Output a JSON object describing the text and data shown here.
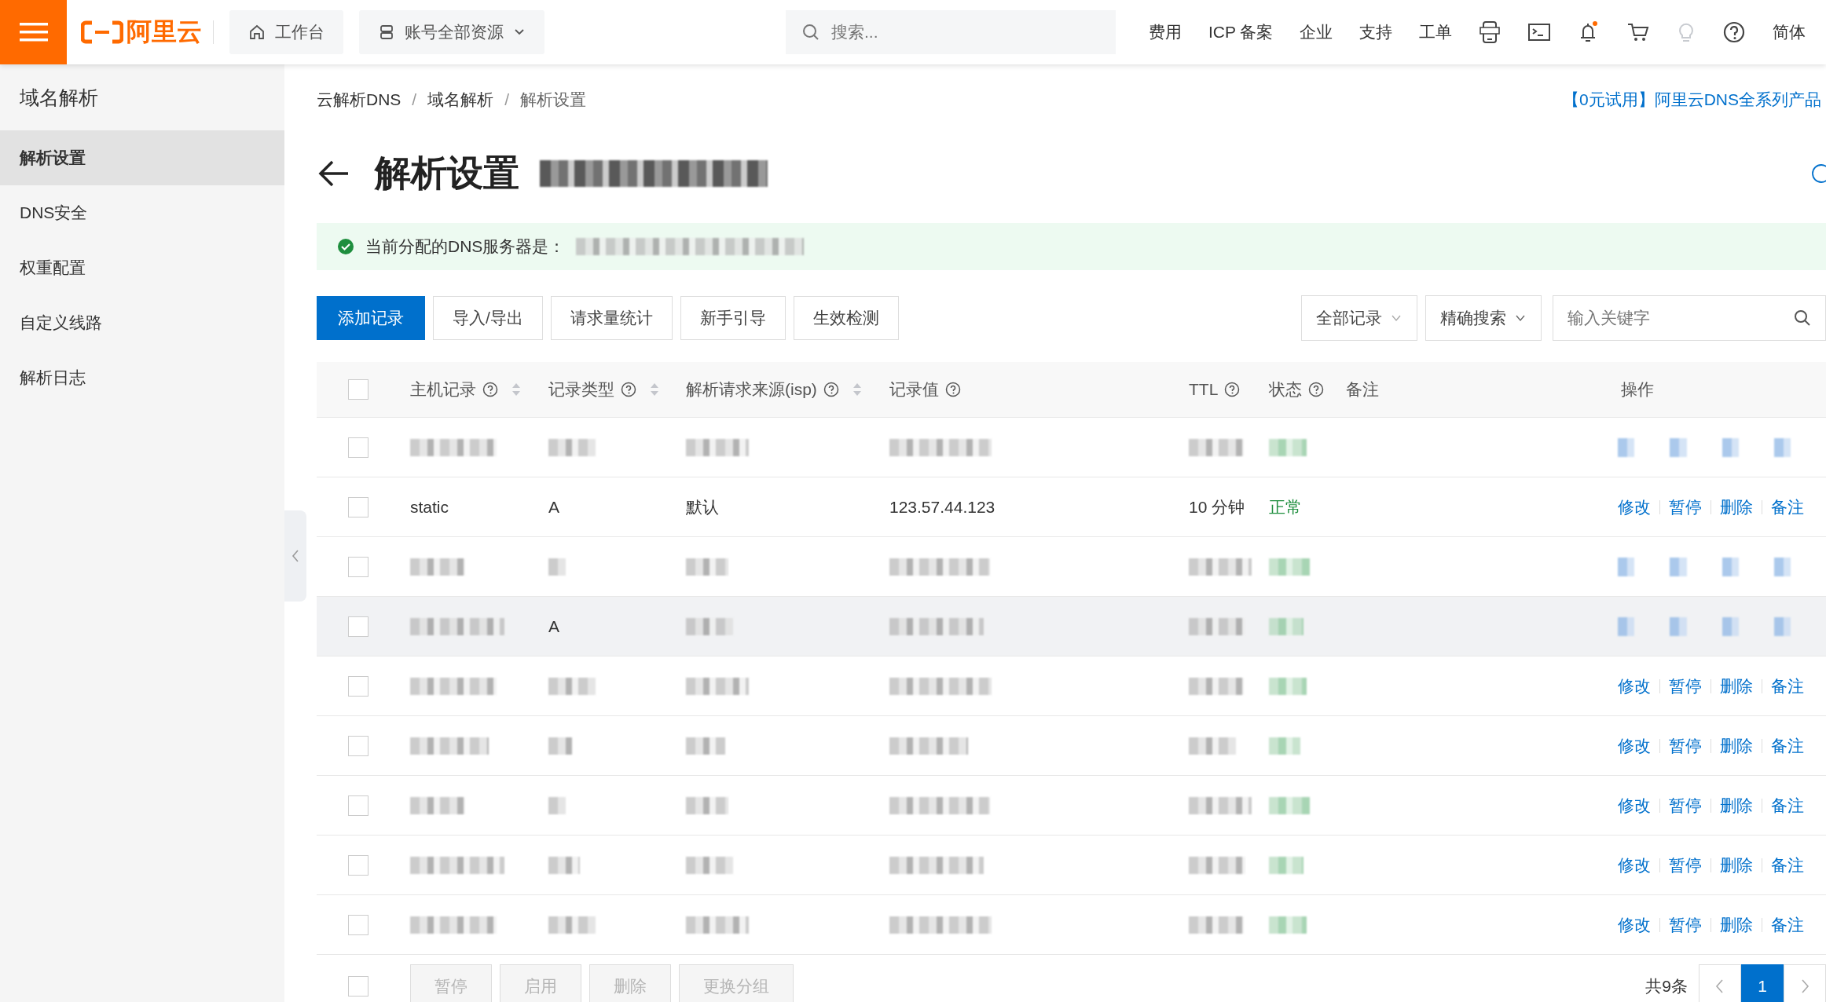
{
  "topbar": {
    "logo_text": "阿里云",
    "workbench": "工作台",
    "resources": "账号全部资源",
    "search": {
      "placeholder": "搜索..."
    },
    "nav": [
      "费用",
      "ICP 备案",
      "企业",
      "支持",
      "工单"
    ],
    "icons": [
      {
        "kind": "app"
      },
      {
        "kind": "terminal"
      },
      {
        "kind": "bell"
      },
      {
        "kind": "cart"
      },
      {
        "kind": "bulb"
      },
      {
        "kind": "help"
      }
    ],
    "language": "简体"
  },
  "sidebar": {
    "title": "域名解析",
    "items": [
      {
        "label": "解析设置",
        "selected": true
      },
      {
        "label": "DNS安全",
        "selected": false
      },
      {
        "label": "权重配置",
        "selected": false
      },
      {
        "label": "自定义线路",
        "selected": false
      },
      {
        "label": "解析日志",
        "selected": false
      }
    ]
  },
  "breadcrumb": [
    {
      "kind": "link",
      "text": "云解析DNS"
    },
    {
      "kind": "separator",
      "text": "/"
    },
    {
      "kind": "link",
      "text": "域名解析"
    },
    {
      "kind": "separator",
      "text": "/"
    },
    {
      "kind": "current",
      "text": "解析设置"
    }
  ],
  "promo": "【0元试用】阿里云DNS全系列产品",
  "title": {
    "text": "解析设置",
    "suffix": {
      "kind": "redacted"
    }
  },
  "notice": {
    "text": "当前分配的DNS服务器是：",
    "value": {
      "kind": "redacted"
    }
  },
  "toolbar": [
    {
      "label": "添加记录",
      "primary": true
    },
    {
      "label": "导入/导出",
      "primary": false
    },
    {
      "label": "请求量统计",
      "primary": false
    },
    {
      "label": "新手引导",
      "primary": false
    },
    {
      "label": "生效检测",
      "primary": false
    }
  ],
  "filters": {
    "scope": "全部记录",
    "match": "精确搜索",
    "search": {
      "placeholder": "输入关键字"
    }
  },
  "table": {
    "all_checked": false,
    "columns": [
      {
        "label": "主机记录",
        "help": true,
        "sortable": true
      },
      {
        "label": "记录类型",
        "help": true,
        "sortable": true
      },
      {
        "label": "解析请求来源(isp)",
        "help": true,
        "sortable": true
      },
      {
        "label": "记录值",
        "help": true,
        "sortable": false
      },
      {
        "label": "TTL",
        "help": true,
        "sortable": false
      },
      {
        "label": "状态",
        "help": true,
        "sortable": false
      },
      {
        "label": "备注",
        "help": false,
        "sortable": false
      },
      {
        "label": "操作",
        "help": false,
        "sortable": false
      }
    ],
    "rows": [
      {
        "checked": false,
        "highlighted": false,
        "cells": [
          {
            "kind": "redacted"
          },
          {
            "kind": "redacted"
          },
          {
            "kind": "redacted"
          },
          {
            "kind": "redacted"
          },
          {
            "kind": "redacted"
          },
          {
            "kind": "redacted"
          }
        ],
        "actions": {
          "kind": "redacted"
        }
      },
      {
        "checked": false,
        "highlighted": false,
        "cells": [
          {
            "kind": "text",
            "text": "static"
          },
          {
            "kind": "text",
            "text": "A"
          },
          {
            "kind": "text",
            "text": "默认"
          },
          {
            "kind": "text",
            "text": "123.57.44.123"
          },
          {
            "kind": "text",
            "text": "10 分钟"
          },
          {
            "kind": "text",
            "text": "正常"
          }
        ],
        "actions": {
          "kind": "links",
          "items": [
            "修改",
            "暂停",
            "删除",
            "备注"
          ]
        }
      },
      {
        "checked": false,
        "highlighted": false,
        "cells": [
          {
            "kind": "redacted"
          },
          {
            "kind": "redacted"
          },
          {
            "kind": "redacted"
          },
          {
            "kind": "redacted"
          },
          {
            "kind": "redacted"
          },
          {
            "kind": "redacted"
          }
        ],
        "actions": {
          "kind": "redacted"
        }
      },
      {
        "checked": false,
        "highlighted": true,
        "cells": [
          {
            "kind": "redacted"
          },
          {
            "kind": "text",
            "text": "A"
          },
          {
            "kind": "redacted"
          },
          {
            "kind": "redacted"
          },
          {
            "kind": "redacted"
          },
          {
            "kind": "redacted"
          }
        ],
        "actions": {
          "kind": "redacted"
        }
      },
      {
        "checked": false,
        "highlighted": false,
        "cells": [
          {
            "kind": "redacted"
          },
          {
            "kind": "redacted"
          },
          {
            "kind": "redacted"
          },
          {
            "kind": "redacted"
          },
          {
            "kind": "redacted"
          },
          {
            "kind": "redacted"
          }
        ],
        "actions": {
          "kind": "links",
          "items": [
            "修改",
            "暂停",
            "删除",
            "备注"
          ]
        }
      },
      {
        "checked": false,
        "highlighted": false,
        "cells": [
          {
            "kind": "redacted"
          },
          {
            "kind": "redacted"
          },
          {
            "kind": "redacted"
          },
          {
            "kind": "redacted"
          },
          {
            "kind": "redacted"
          },
          {
            "kind": "redacted"
          }
        ],
        "actions": {
          "kind": "links",
          "items": [
            "修改",
            "暂停",
            "删除",
            "备注"
          ]
        }
      },
      {
        "checked": false,
        "highlighted": false,
        "cells": [
          {
            "kind": "redacted"
          },
          {
            "kind": "redacted"
          },
          {
            "kind": "redacted"
          },
          {
            "kind": "redacted"
          },
          {
            "kind": "redacted"
          },
          {
            "kind": "redacted"
          }
        ],
        "actions": {
          "kind": "links",
          "items": [
            "修改",
            "暂停",
            "删除",
            "备注"
          ]
        }
      },
      {
        "checked": false,
        "highlighted": false,
        "cells": [
          {
            "kind": "redacted"
          },
          {
            "kind": "redacted"
          },
          {
            "kind": "redacted"
          },
          {
            "kind": "redacted"
          },
          {
            "kind": "redacted"
          },
          {
            "kind": "redacted"
          }
        ],
        "actions": {
          "kind": "links",
          "items": [
            "修改",
            "暂停",
            "删除",
            "备注"
          ]
        }
      },
      {
        "checked": false,
        "highlighted": false,
        "cells": [
          {
            "kind": "redacted"
          },
          {
            "kind": "redacted"
          },
          {
            "kind": "redacted"
          },
          {
            "kind": "redacted"
          },
          {
            "kind": "redacted"
          },
          {
            "kind": "redacted"
          }
        ],
        "actions": {
          "kind": "links",
          "items": [
            "修改",
            "暂停",
            "删除",
            "备注"
          ]
        }
      }
    ]
  },
  "footer": {
    "checked": false,
    "batch": [
      {
        "label": "暂停",
        "disabled": true
      },
      {
        "label": "启用",
        "disabled": true
      },
      {
        "label": "删除",
        "disabled": true
      },
      {
        "label": "更换分组",
        "disabled": true
      }
    ],
    "total": "共9条",
    "pages": [
      {
        "label": "1",
        "selected": true
      }
    ]
  }
}
